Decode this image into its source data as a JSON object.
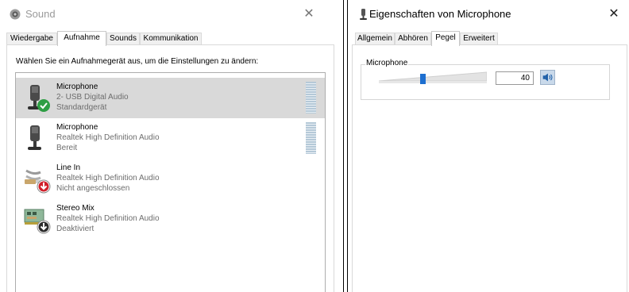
{
  "left_window": {
    "title": "Sound",
    "close_glyph": "✕",
    "tabs": [
      {
        "label": "Wiedergabe",
        "active": false
      },
      {
        "label": "Aufnahme",
        "active": true
      },
      {
        "label": "Sounds",
        "active": false
      },
      {
        "label": "Kommunikation",
        "active": false
      }
    ],
    "instruction": "Wählen Sie ein Aufnahmegerät aus, um die Einstellungen zu ändern:",
    "devices": [
      {
        "name": "Microphone",
        "driver": "2- USB Digital Audio",
        "status": "Standardgerät",
        "icon": "microphone-icon",
        "status_icon": "default-check-icon",
        "selected": true
      },
      {
        "name": "Microphone",
        "driver": "Realtek High Definition Audio",
        "status": "Bereit",
        "icon": "microphone-icon",
        "status_icon": null,
        "selected": false
      },
      {
        "name": "Line In",
        "driver": "Realtek High Definition Audio",
        "status": "Nicht angeschlossen",
        "icon": "line-in-cable-icon",
        "status_icon": "not-connected-arrow-icon",
        "selected": false
      },
      {
        "name": "Stereo Mix",
        "driver": "Realtek High Definition Audio",
        "status": "Deaktiviert",
        "icon": "sound-card-icon",
        "status_icon": "disabled-arrow-icon",
        "selected": false
      }
    ]
  },
  "right_window": {
    "title": "Eigenschaften von Microphone",
    "close_glyph": "✕",
    "tabs": [
      {
        "label": "Allgemein",
        "active": false
      },
      {
        "label": "Abhören",
        "active": false
      },
      {
        "label": "Pegel",
        "active": true
      },
      {
        "label": "Erweitert",
        "active": false
      }
    ],
    "level_group_label": "Microphone",
    "volume_value": "40",
    "volume_fraction": 0.4,
    "speaker_icon": "speaker-icon"
  },
  "colors": {
    "selection_bg": "#d9d9d9",
    "check_green": "#2e9e44",
    "warning_red": "#d0202a",
    "accent_blue": "#1e6fd0"
  }
}
